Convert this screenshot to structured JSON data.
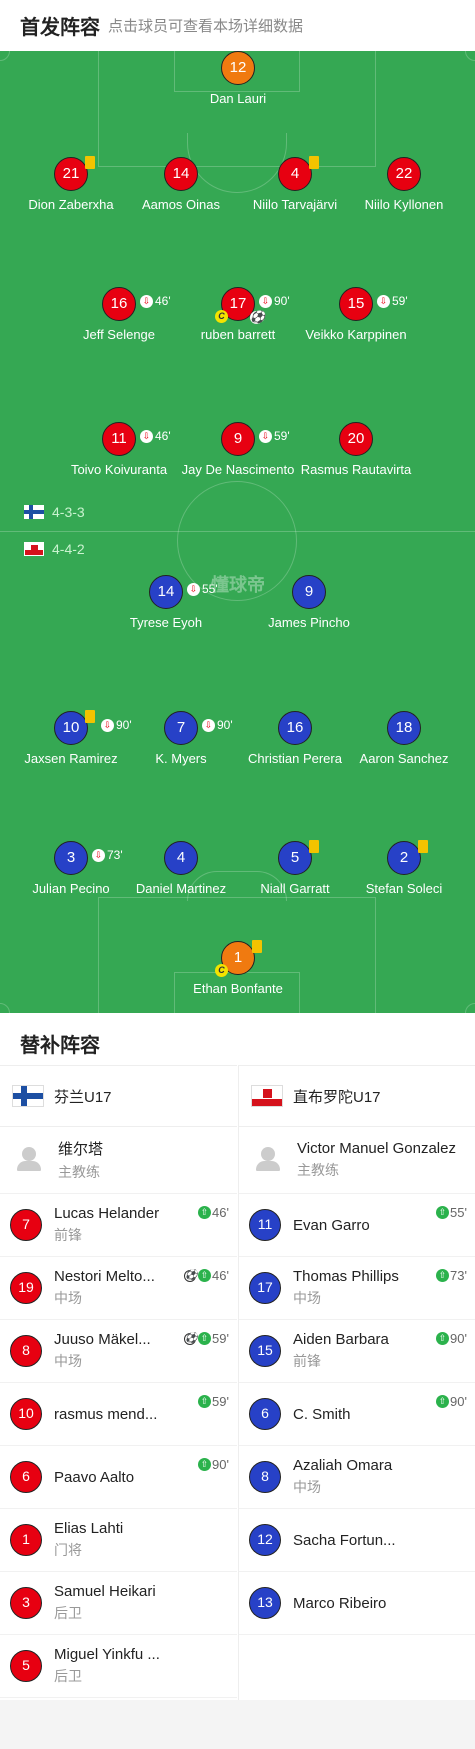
{
  "header": {
    "title": "首发阵容",
    "subtitle": "点击球员可查看本场详细数据"
  },
  "pitch": {
    "watermark": "懂球帝",
    "home_formation": "4-3-3",
    "away_formation": "4-4-2"
  },
  "home_lineup": [
    {
      "num": "12",
      "name": "Dan Lauri"
    },
    {
      "num": "21",
      "name": "Dion Zaberxha"
    },
    {
      "num": "14",
      "name": "Aamos Oinas"
    },
    {
      "num": "4",
      "name": "Niilo Tarvajärvi"
    },
    {
      "num": "22",
      "name": "Niilo Kyllonen"
    },
    {
      "num": "16",
      "name": "Jeff Selenge",
      "sub": "46'"
    },
    {
      "num": "17",
      "name": "ruben barrett",
      "sub": "90'"
    },
    {
      "num": "15",
      "name": "Veikko Karppinen",
      "sub": "59'"
    },
    {
      "num": "11",
      "name": "Toivo Koivuranta",
      "sub": "46'"
    },
    {
      "num": "9",
      "name": "Jay De Nascimento",
      "sub": "59'"
    },
    {
      "num": "20",
      "name": "Rasmus Rautavirta"
    }
  ],
  "away_lineup": [
    {
      "num": "14",
      "name": "Tyrese Eyoh",
      "sub": "55'"
    },
    {
      "num": "9",
      "name": "James Pincho"
    },
    {
      "num": "10",
      "name": "Jaxsen Ramirez",
      "sub": "90'"
    },
    {
      "num": "7",
      "name": "K. Myers",
      "sub": "90'"
    },
    {
      "num": "16",
      "name": "Christian Perera"
    },
    {
      "num": "18",
      "name": "Aaron Sanchez"
    },
    {
      "num": "3",
      "name": "Julian Pecino",
      "sub": "73'"
    },
    {
      "num": "4",
      "name": "Daniel Martinez"
    },
    {
      "num": "5",
      "name": "Niall Garratt"
    },
    {
      "num": "2",
      "name": "Stefan Soleci"
    },
    {
      "num": "1",
      "name": "Ethan Bonfante"
    }
  ],
  "icons": {
    "yellow_card": "yellow-card-icon",
    "captain": "C",
    "goal": "soccer-ball-icon",
    "sub_off": "sub-off-icon",
    "sub_on": "sub-on-icon"
  },
  "subs": {
    "title": "替补阵容",
    "home": {
      "team": "芬兰U17",
      "coach_name": "维尔塔",
      "coach_role": "主教练",
      "players": [
        {
          "num": "7",
          "name": "Lucas Helander",
          "pos": "前锋",
          "time": "46'"
        },
        {
          "num": "19",
          "name": "Nestori Melto...",
          "pos": "中场",
          "time": "46'",
          "goal": true
        },
        {
          "num": "8",
          "name": "Juuso Mäkel...",
          "pos": "中场",
          "time": "59'",
          "goal": true
        },
        {
          "num": "10",
          "name": "rasmus mend...",
          "pos": "",
          "time": "59'"
        },
        {
          "num": "6",
          "name": "Paavo Aalto",
          "pos": "",
          "time": "90'"
        },
        {
          "num": "1",
          "name": "Elias Lahti",
          "pos": "门将",
          "time": ""
        },
        {
          "num": "3",
          "name": "Samuel Heikari",
          "pos": "后卫",
          "time": ""
        },
        {
          "num": "5",
          "name": "Miguel Yinkfu ...",
          "pos": "后卫",
          "time": ""
        }
      ]
    },
    "away": {
      "team": "直布罗陀U17",
      "coach_name": "Victor Manuel Gonzalez",
      "coach_role": "主教练",
      "players": [
        {
          "num": "11",
          "name": "Evan Garro",
          "pos": "",
          "time": "55'"
        },
        {
          "num": "17",
          "name": "Thomas Phillips",
          "pos": "中场",
          "time": "73'"
        },
        {
          "num": "15",
          "name": "Aiden Barbara",
          "pos": "前锋",
          "time": "90'"
        },
        {
          "num": "6",
          "name": "C. Smith",
          "pos": "",
          "time": "90'"
        },
        {
          "num": "8",
          "name": "Azaliah Omara",
          "pos": "中场",
          "time": ""
        },
        {
          "num": "12",
          "name": "Sacha Fortun...",
          "pos": "",
          "time": ""
        },
        {
          "num": "13",
          "name": "Marco Ribeiro",
          "pos": "",
          "time": ""
        }
      ]
    }
  },
  "colors": {
    "pitch": "#35a853",
    "home": "#e70011",
    "away": "#2741c7",
    "keeper": "#f07a10"
  }
}
